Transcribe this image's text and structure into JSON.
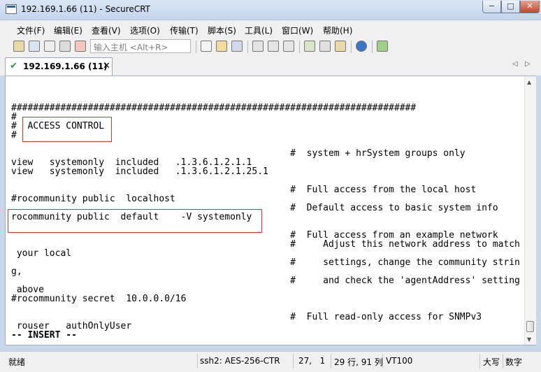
{
  "window": {
    "title": "192.169.1.66 (11) - SecureCRT",
    "buttons": {
      "minimize": "−",
      "maximize": "□",
      "close": "✕"
    }
  },
  "menu": [
    "文件(F)",
    "编辑(E)",
    "查看(V)",
    "选项(O)",
    "传输(T)",
    "脚本(S)",
    "工具(L)",
    "窗口(W)",
    "帮助(H)"
  ],
  "toolbar": {
    "quick_connect_placeholder": "输入主机 <Alt+R>",
    "icons": [
      "connect-icon",
      "quick-connect-icon",
      "connect-tab-icon",
      "reconnect-icon",
      "disconnect-icon",
      "copy-icon",
      "paste-icon",
      "find-icon",
      "print-icon",
      "print-setup-icon",
      "print-selection-icon",
      "session-options-icon",
      "global-options-icon",
      "keymap-icon",
      "help-icon",
      "sftp-icon"
    ]
  },
  "tab": {
    "label": "192.169.1.66 (11)",
    "close": "✕",
    "prev": "◁",
    "next": "▷"
  },
  "terminal": {
    "lines": [
      "##########################################################################",
      "#",
      "#  ACCESS CONTROL",
      "#",
      "                                                   #  system + hrSystem groups only",
      "view   systemonly  included   .1.3.6.1.2.1.1",
      "view   systemonly  included   .1.3.6.1.2.1.25.1",
      "",
      "                                                   #  Full access from the local host",
      "#rocommunity public  localhost",
      "                                                   #  Default access to basic system info",
      "rocommunity public  default    -V systemonly",
      "",
      "                                                   #  Full access from an example network",
      "                                                   #     Adjust this network address to match",
      " your local",
      "                                                   #     settings, change the community strin",
      "g,",
      "                                                   #     and check the 'agentAddress' setting",
      " above",
      "#rocommunity secret  10.0.0.0/16",
      "",
      "                                                   #  Full read-only access for SNMPv3",
      " rouser   authOnlyUser",
      "-- INSERT --"
    ]
  },
  "status": {
    "ready": "就绪",
    "cipher": "ssh2: AES-256-CTR",
    "position": "27,   1",
    "size": "29 行, 91 列",
    "terminal_type": "VT100",
    "caps": "大写",
    "num": "数字"
  }
}
